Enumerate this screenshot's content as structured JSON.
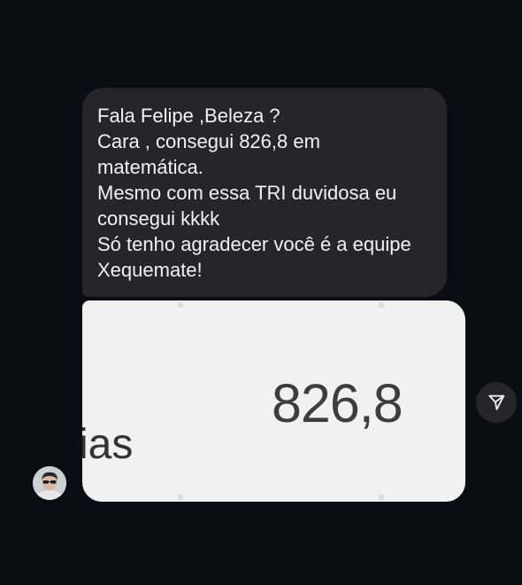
{
  "message": {
    "lines": [
      "Fala Felipe ,Beleza ?",
      "Cara , consegui 826,8 em",
      "matemática.",
      "Mesmo com essa TRI duvidosa eu",
      "consegui kkkk",
      "Só tenho agradecer você é a equipe",
      "Xequemate!"
    ]
  },
  "attachment": {
    "score": "826,8",
    "partial_word": "ias"
  },
  "icons": {
    "share": "paper-plane-icon",
    "avatar": "user-avatar"
  },
  "colors": {
    "background": "#0b0c14",
    "bubble": "#262629",
    "image_bg": "#f1f1f1"
  }
}
